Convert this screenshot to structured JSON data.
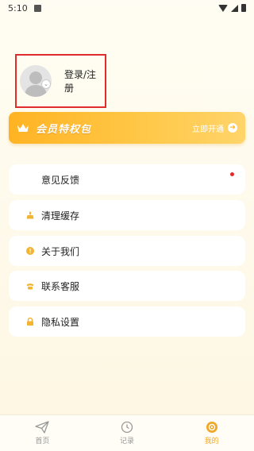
{
  "status_bar": {
    "time": "5:10"
  },
  "profile": {
    "login_label": "登录/注册"
  },
  "vip": {
    "title": "会员特权包",
    "action": "立即开通",
    "action_icon": "arrow-right-icon"
  },
  "menu": [
    {
      "label": "意见反馈",
      "icon": "none",
      "has_dot": true
    },
    {
      "label": "清理缓存",
      "icon": "broom-icon"
    },
    {
      "label": "关于我们",
      "icon": "info-icon"
    },
    {
      "label": "联系客服",
      "icon": "phone-icon"
    },
    {
      "label": "隐私设置",
      "icon": "lock-icon"
    }
  ],
  "tabs": [
    {
      "label": "首页",
      "icon": "paper-plane-icon",
      "active": false
    },
    {
      "label": "记录",
      "icon": "clock-icon",
      "active": false
    },
    {
      "label": "我的",
      "icon": "settings-icon",
      "active": true
    }
  ],
  "colors": {
    "accent": "#f0a82a",
    "vip_gradient_start": "#ffb323",
    "highlight_border": "#e02c2c",
    "dot": "#e02c2c"
  }
}
